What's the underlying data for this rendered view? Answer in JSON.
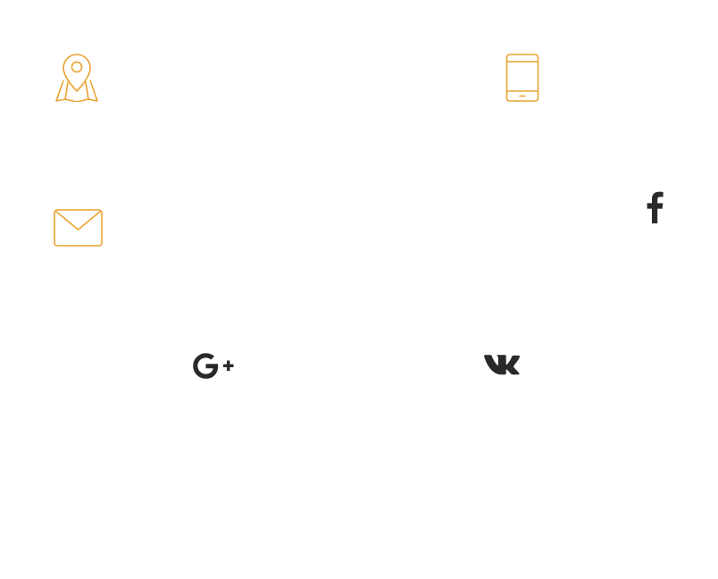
{
  "colors": {
    "accent": "#E9A331",
    "social": "#2A2A2A",
    "background": "#FFFFFF"
  },
  "contacts": [
    {
      "icon": "map-location-icon"
    },
    {
      "icon": "tablet-phone-icon"
    },
    {
      "icon": "envelope-icon"
    }
  ],
  "social": [
    {
      "icon": "facebook-icon"
    },
    {
      "icon": "google-plus-icon"
    },
    {
      "icon": "vk-icon"
    }
  ]
}
